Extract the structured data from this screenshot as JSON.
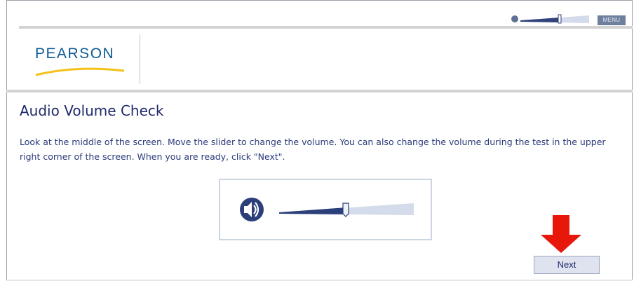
{
  "header": {
    "menu_label": "MENU",
    "volume_level": 0.6
  },
  "logo": {
    "text": "PEARSON"
  },
  "page": {
    "title": "Audio Volume Check",
    "instructions": "Look at the middle of the screen. Move the slider to change the volume. You can also change the volume during the test in the upper right corner of the screen. When you are ready, click \"Next\"."
  },
  "volume_panel": {
    "icon": "speaker-icon",
    "level": 0.5
  },
  "next_button": {
    "label": "Next"
  },
  "colors": {
    "accent_red": "#e8170b",
    "title_blue": "#1f2a6b",
    "logo_blue": "#0d5a93",
    "logo_yellow": "#f3c21a"
  }
}
